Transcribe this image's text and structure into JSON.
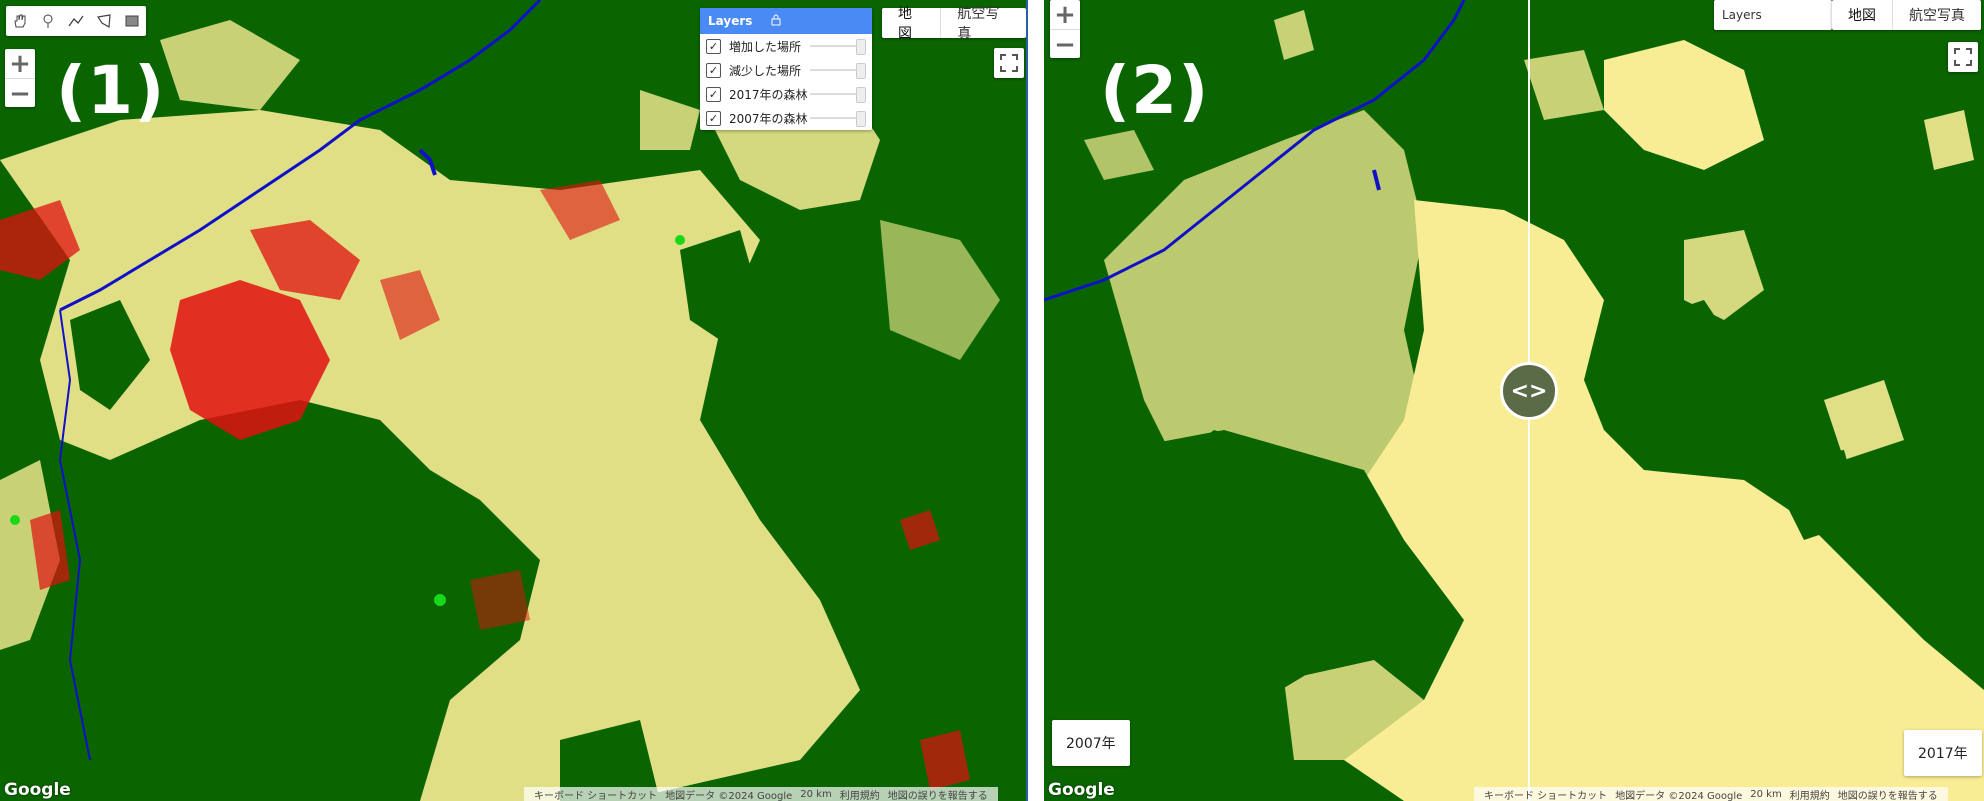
{
  "panel1": {
    "label": "(1)",
    "toolbar": [
      "hand-icon",
      "pin-icon",
      "line-icon",
      "polygon-icon",
      "rectangle-icon"
    ],
    "zoom": {
      "in": "+",
      "out": "−"
    },
    "maptype": {
      "map": "地図",
      "satellite": "航空写真"
    },
    "layers": {
      "title": "Layers",
      "items": [
        {
          "label": "増加した場所",
          "checked": true
        },
        {
          "label": "減少した場所",
          "checked": true
        },
        {
          "label": "2017年の森林",
          "checked": true
        },
        {
          "label": "2007年の森林",
          "checked": true
        }
      ]
    },
    "attribution": {
      "shortcuts": "キーボード ショートカット",
      "data": "地図データ ©2024 Google",
      "scale": "20 km",
      "terms": "利用規約",
      "report": "地図の誤りを報告する"
    },
    "google": "Google"
  },
  "panel2": {
    "label": "(2)",
    "zoom": {
      "in": "+",
      "out": "−"
    },
    "layers_button": "Layers",
    "maptype": {
      "map": "地図",
      "satellite": "航空写真"
    },
    "left_year": "2007年",
    "right_year": "2017年",
    "swipe_glyph": "<>",
    "attribution": {
      "shortcuts": "キーボード ショートカット",
      "data": "地図データ ©2024 Google",
      "scale": "20 km",
      "terms": "利用規約",
      "report": "地図の誤りを報告する"
    },
    "google": "Google"
  },
  "colors": {
    "forest": "#0a6400",
    "nonforest": "#f8ec94",
    "loss": "#e01010",
    "gain": "#18d818",
    "river": "#1010c8",
    "layers_header": "#4a8af4"
  }
}
